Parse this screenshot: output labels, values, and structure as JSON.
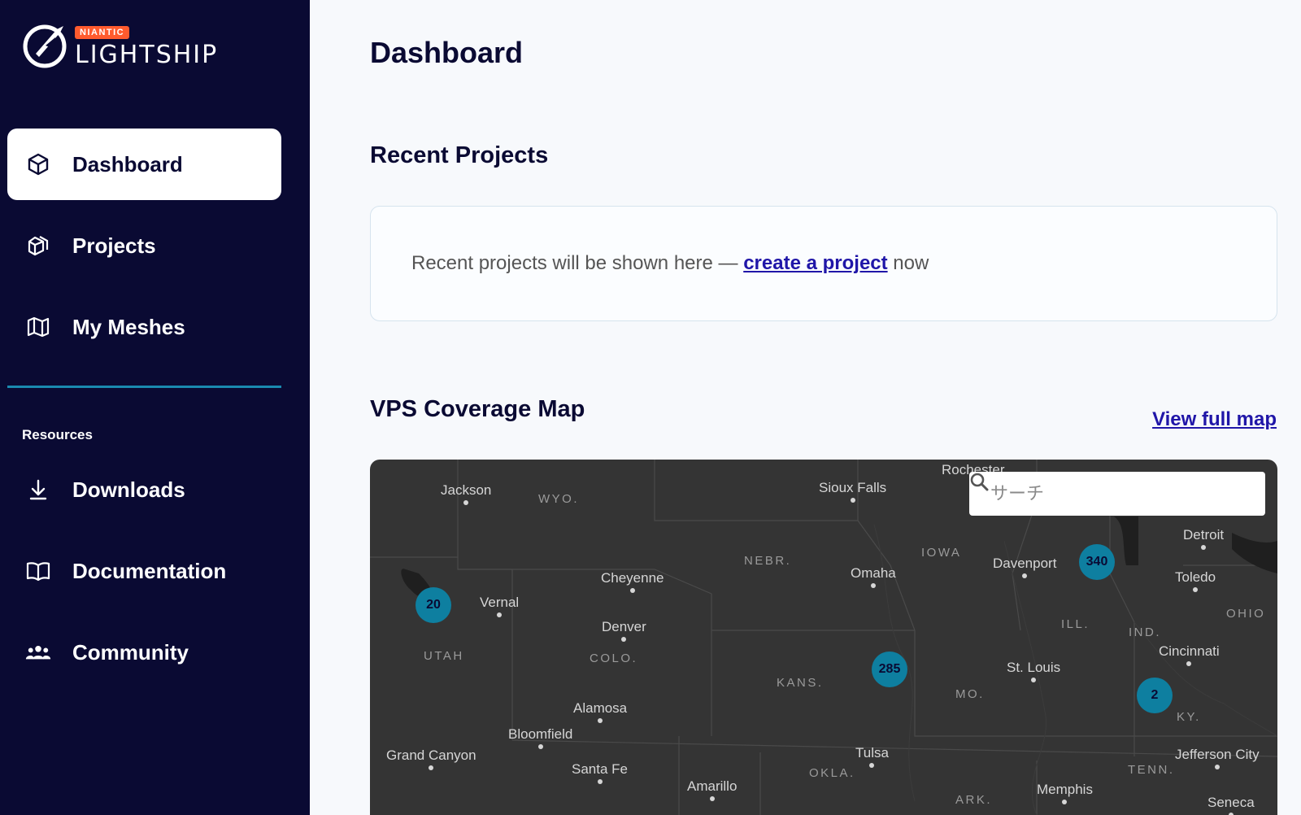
{
  "brand": {
    "badge": "NIANTIC",
    "name": "LIGHTSHIP"
  },
  "sidebar": {
    "items": [
      {
        "label": "Dashboard",
        "icon": "cube-icon",
        "active": true
      },
      {
        "label": "Projects",
        "icon": "cubes-icon"
      },
      {
        "label": "My Meshes",
        "icon": "map-icon"
      }
    ],
    "resources_label": "Resources",
    "resources": [
      {
        "label": "Downloads",
        "icon": "download-icon"
      },
      {
        "label": "Documentation",
        "icon": "book-icon"
      },
      {
        "label": "Community",
        "icon": "people-icon"
      }
    ]
  },
  "main": {
    "title": "Dashboard",
    "recent": {
      "heading": "Recent Projects",
      "message_before": "Recent projects will be shown here —",
      "link": "create a project",
      "message_after": "now"
    },
    "map_section": {
      "heading": "VPS Coverage Map",
      "view_full": "View full map",
      "search_placeholder": "サーチ"
    }
  },
  "map": {
    "cities": [
      "Jackson",
      "Sioux Falls",
      "Rochester",
      "Detroit",
      "Cheyenne",
      "Omaha",
      "Davenport",
      "Toledo",
      "Vernal",
      "Denver",
      "St. Louis",
      "Cincinnati",
      "Alamosa",
      "Bloomfield",
      "Grand Canyon",
      "Santa Fe",
      "Amarillo",
      "Tulsa",
      "Memphis",
      "Jefferson City",
      "Seneca"
    ],
    "states": [
      "WYO.",
      "NEBR.",
      "IOWA",
      "ILL.",
      "IND.",
      "OHIO",
      "UTAH",
      "COLO.",
      "KANS.",
      "MO.",
      "KY.",
      "OKLA.",
      "TENN.",
      "ARK."
    ],
    "clusters": [
      "20",
      "285",
      "340",
      "2"
    ],
    "colors": {
      "background": "#343434",
      "cluster": "#0e7fa0",
      "sidebar": "#0a0a33",
      "link": "#2016a8",
      "badge": "#ff5b2e"
    }
  }
}
